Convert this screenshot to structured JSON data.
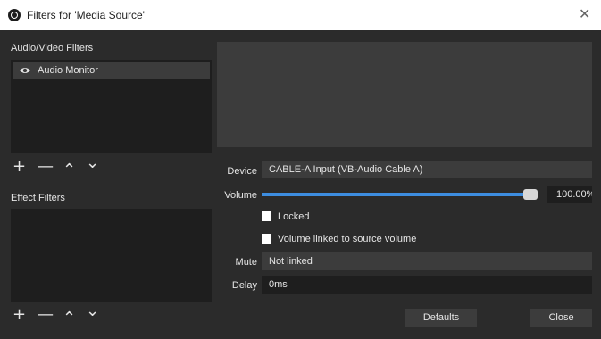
{
  "window": {
    "title": "Filters for 'Media Source'"
  },
  "av_filters": {
    "header": "Audio/Video Filters",
    "items": [
      {
        "label": "Audio Monitor",
        "icon": "eye-icon"
      }
    ]
  },
  "effect_filters": {
    "header": "Effect Filters"
  },
  "toolbar_glyphs": {
    "add": "+",
    "remove": "—",
    "up": "⌃",
    "down": "⌄"
  },
  "properties": {
    "device_label": "Device",
    "device_value": "CABLE-A Input (VB-Audio Cable A)",
    "volume_label": "Volume",
    "volume_value": "100.00%",
    "volume_fraction": 1.0,
    "locked_label": "Locked",
    "linked_label": "Volume linked to source volume",
    "mute_label": "Mute",
    "mute_value": "Not linked",
    "delay_label": "Delay",
    "delay_value": "0ms"
  },
  "buttons": {
    "defaults": "Defaults",
    "close": "Close"
  },
  "colors": {
    "accent": "#3d8de0",
    "panel": "#2b2b2b",
    "list": "#1e1e1e",
    "field": "#3c3c3c"
  }
}
